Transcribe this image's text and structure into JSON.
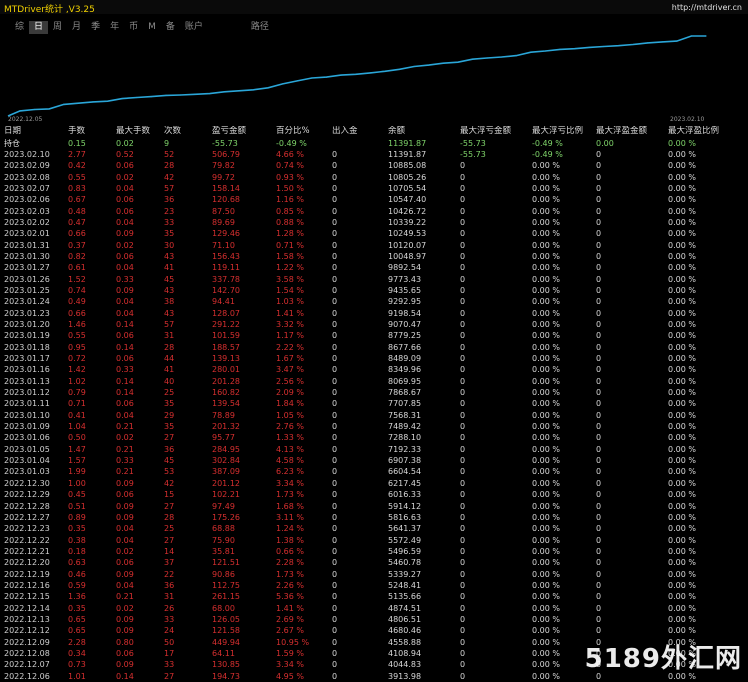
{
  "app": {
    "title": "MTDriver统计 ,V3.25",
    "url": "http://mtdriver.cn"
  },
  "tabs": [
    {
      "label": "综",
      "active": false
    },
    {
      "label": "日",
      "active": true
    },
    {
      "label": "周",
      "active": false
    },
    {
      "label": "月",
      "active": false
    },
    {
      "label": "季",
      "active": false
    },
    {
      "label": "年",
      "active": false
    },
    {
      "label": "币",
      "active": false
    },
    {
      "label": "M",
      "active": false
    },
    {
      "label": "备",
      "active": false
    },
    {
      "label": "账户",
      "active": false
    },
    {
      "label": "路径",
      "active": false
    }
  ],
  "chart_data": {
    "type": "line",
    "title": "",
    "xlabel": "",
    "ylabel": "",
    "x_start_label": "2022.12.05",
    "x_end_label": "2023.02.10",
    "line_color": "#2aa6d8",
    "grid": false,
    "series": [
      {
        "x": [
          "2022.12.06",
          "2022.12.07",
          "2022.12.08",
          "2022.12.09",
          "2022.12.12",
          "2022.12.13",
          "2022.12.14",
          "2022.12.15",
          "2022.12.16",
          "2022.12.19",
          "2022.12.20",
          "2022.12.21",
          "2022.12.22",
          "2022.12.23",
          "2022.12.26",
          "2022.12.27",
          "2022.12.28",
          "2022.12.29",
          "2022.12.30",
          "2023.01.03",
          "2023.01.04",
          "2023.01.05",
          "2023.01.06",
          "2023.01.09",
          "2023.01.10",
          "2023.01.11",
          "2023.01.12",
          "2023.01.13",
          "2023.01.16",
          "2023.01.17",
          "2023.01.18",
          "2023.01.19",
          "2023.01.20",
          "2023.01.23",
          "2023.01.24",
          "2023.01.25",
          "2023.01.26",
          "2023.01.27",
          "2023.01.30",
          "2023.01.31",
          "2023.02.01",
          "2023.02.02",
          "2023.02.03",
          "2023.02.06",
          "2023.02.07",
          "2023.02.08",
          "2023.02.09",
          "2023.02.10"
        ],
        "values": [
          3913.98,
          4044.83,
          4108.94,
          4558.88,
          4680.46,
          4806.51,
          4874.51,
          5135.66,
          5248.41,
          5339.27,
          5460.78,
          5496.59,
          5572.49,
          5641.37,
          5816.63,
          5914.12,
          6016.33,
          6217.45,
          6604.54,
          6907.38,
          7192.33,
          7288.1,
          7489.42,
          7568.31,
          7707.85,
          7868.67,
          8069.95,
          8349.96,
          8489.09,
          8677.66,
          8779.25,
          9070.47,
          9198.54,
          9292.95,
          9435.65,
          9773.43,
          9892.54,
          10048.97,
          10120.07,
          10249.53,
          10339.22,
          10426.72,
          10547.4,
          10705.54,
          10805.26,
          10885.08,
          11391.87,
          11391.87
        ]
      }
    ]
  },
  "table": {
    "headers": [
      "日期",
      "手数",
      "最大手数",
      "次数",
      "盈亏金额",
      "百分比%",
      "出入金",
      "余额",
      "最大浮亏金额",
      "最大浮亏比例",
      "最大浮盈金额",
      "最大浮盈比例"
    ],
    "hold_row": [
      "持仓",
      "0.15",
      "0.02",
      "9",
      "-55.73",
      "-0.49 %",
      "",
      "11391.87",
      "-55.73",
      "-0.49 %",
      "0.00",
      "0.00 %"
    ],
    "rows": [
      [
        "2023.02.10",
        "2.77",
        "0.52",
        "52",
        "506.79",
        "4.66 %",
        "0",
        "11391.87",
        "-55.73",
        "-0.49 %",
        "0",
        "0.00 %"
      ],
      [
        "2023.02.09",
        "0.42",
        "0.06",
        "28",
        "79.82",
        "0.74 %",
        "0",
        "10885.08",
        "0",
        "0.00 %",
        "0",
        "0.00 %"
      ],
      [
        "2023.02.08",
        "0.55",
        "0.02",
        "42",
        "99.72",
        "0.93 %",
        "0",
        "10805.26",
        "0",
        "0.00 %",
        "0",
        "0.00 %"
      ],
      [
        "2023.02.07",
        "0.83",
        "0.04",
        "57",
        "158.14",
        "1.50 %",
        "0",
        "10705.54",
        "0",
        "0.00 %",
        "0",
        "0.00 %"
      ],
      [
        "2023.02.06",
        "0.67",
        "0.06",
        "36",
        "120.68",
        "1.16 %",
        "0",
        "10547.40",
        "0",
        "0.00 %",
        "0",
        "0.00 %"
      ],
      [
        "2023.02.03",
        "0.48",
        "0.06",
        "23",
        "87.50",
        "0.85 %",
        "0",
        "10426.72",
        "0",
        "0.00 %",
        "0",
        "0.00 %"
      ],
      [
        "2023.02.02",
        "0.47",
        "0.04",
        "33",
        "89.69",
        "0.88 %",
        "0",
        "10339.22",
        "0",
        "0.00 %",
        "0",
        "0.00 %"
      ],
      [
        "2023.02.01",
        "0.66",
        "0.09",
        "35",
        "129.46",
        "1.28 %",
        "0",
        "10249.53",
        "0",
        "0.00 %",
        "0",
        "0.00 %"
      ],
      [
        "2023.01.31",
        "0.37",
        "0.02",
        "30",
        "71.10",
        "0.71 %",
        "0",
        "10120.07",
        "0",
        "0.00 %",
        "0",
        "0.00 %"
      ],
      [
        "2023.01.30",
        "0.82",
        "0.06",
        "43",
        "156.43",
        "1.58 %",
        "0",
        "10048.97",
        "0",
        "0.00 %",
        "0",
        "0.00 %"
      ],
      [
        "2023.01.27",
        "0.61",
        "0.04",
        "41",
        "119.11",
        "1.22 %",
        "0",
        "9892.54",
        "0",
        "0.00 %",
        "0",
        "0.00 %"
      ],
      [
        "2023.01.26",
        "1.52",
        "0.33",
        "45",
        "337.78",
        "3.58 %",
        "0",
        "9773.43",
        "0",
        "0.00 %",
        "0",
        "0.00 %"
      ],
      [
        "2023.01.25",
        "0.74",
        "0.09",
        "43",
        "142.70",
        "1.54 %",
        "0",
        "9435.65",
        "0",
        "0.00 %",
        "0",
        "0.00 %"
      ],
      [
        "2023.01.24",
        "0.49",
        "0.04",
        "38",
        "94.41",
        "1.03 %",
        "0",
        "9292.95",
        "0",
        "0.00 %",
        "0",
        "0.00 %"
      ],
      [
        "2023.01.23",
        "0.66",
        "0.04",
        "43",
        "128.07",
        "1.41 %",
        "0",
        "9198.54",
        "0",
        "0.00 %",
        "0",
        "0.00 %"
      ],
      [
        "2023.01.20",
        "1.46",
        "0.14",
        "57",
        "291.22",
        "3.32 %",
        "0",
        "9070.47",
        "0",
        "0.00 %",
        "0",
        "0.00 %"
      ],
      [
        "2023.01.19",
        "0.55",
        "0.06",
        "31",
        "101.59",
        "1.17 %",
        "0",
        "8779.25",
        "0",
        "0.00 %",
        "0",
        "0.00 %"
      ],
      [
        "2023.01.18",
        "0.95",
        "0.14",
        "28",
        "188.57",
        "2.22 %",
        "0",
        "8677.66",
        "0",
        "0.00 %",
        "0",
        "0.00 %"
      ],
      [
        "2023.01.17",
        "0.72",
        "0.06",
        "44",
        "139.13",
        "1.67 %",
        "0",
        "8489.09",
        "0",
        "0.00 %",
        "0",
        "0.00 %"
      ],
      [
        "2023.01.16",
        "1.42",
        "0.33",
        "41",
        "280.01",
        "3.47 %",
        "0",
        "8349.96",
        "0",
        "0.00 %",
        "0",
        "0.00 %"
      ],
      [
        "2023.01.13",
        "1.02",
        "0.14",
        "40",
        "201.28",
        "2.56 %",
        "0",
        "8069.95",
        "0",
        "0.00 %",
        "0",
        "0.00 %"
      ],
      [
        "2023.01.12",
        "0.79",
        "0.14",
        "25",
        "160.82",
        "2.09 %",
        "0",
        "7868.67",
        "0",
        "0.00 %",
        "0",
        "0.00 %"
      ],
      [
        "2023.01.11",
        "0.71",
        "0.06",
        "35",
        "139.54",
        "1.84 %",
        "0",
        "7707.85",
        "0",
        "0.00 %",
        "0",
        "0.00 %"
      ],
      [
        "2023.01.10",
        "0.41",
        "0.04",
        "29",
        "78.89",
        "1.05 %",
        "0",
        "7568.31",
        "0",
        "0.00 %",
        "0",
        "0.00 %"
      ],
      [
        "2023.01.09",
        "1.04",
        "0.21",
        "35",
        "201.32",
        "2.76 %",
        "0",
        "7489.42",
        "0",
        "0.00 %",
        "0",
        "0.00 %"
      ],
      [
        "2023.01.06",
        "0.50",
        "0.02",
        "27",
        "95.77",
        "1.33 %",
        "0",
        "7288.10",
        "0",
        "0.00 %",
        "0",
        "0.00 %"
      ],
      [
        "2023.01.05",
        "1.47",
        "0.21",
        "36",
        "284.95",
        "4.13 %",
        "0",
        "7192.33",
        "0",
        "0.00 %",
        "0",
        "0.00 %"
      ],
      [
        "2023.01.04",
        "1.57",
        "0.33",
        "45",
        "302.84",
        "4.58 %",
        "0",
        "6907.38",
        "0",
        "0.00 %",
        "0",
        "0.00 %"
      ],
      [
        "2023.01.03",
        "1.99",
        "0.21",
        "53",
        "387.09",
        "6.23 %",
        "0",
        "6604.54",
        "0",
        "0.00 %",
        "0",
        "0.00 %"
      ],
      [
        "2022.12.30",
        "1.00",
        "0.09",
        "42",
        "201.12",
        "3.34 %",
        "0",
        "6217.45",
        "0",
        "0.00 %",
        "0",
        "0.00 %"
      ],
      [
        "2022.12.29",
        "0.45",
        "0.06",
        "15",
        "102.21",
        "1.73 %",
        "0",
        "6016.33",
        "0",
        "0.00 %",
        "0",
        "0.00 %"
      ],
      [
        "2022.12.28",
        "0.51",
        "0.09",
        "27",
        "97.49",
        "1.68 %",
        "0",
        "5914.12",
        "0",
        "0.00 %",
        "0",
        "0.00 %"
      ],
      [
        "2022.12.27",
        "0.89",
        "0.09",
        "28",
        "175.26",
        "3.11 %",
        "0",
        "5816.63",
        "0",
        "0.00 %",
        "0",
        "0.00 %"
      ],
      [
        "2022.12.23",
        "0.35",
        "0.04",
        "25",
        "68.88",
        "1.24 %",
        "0",
        "5641.37",
        "0",
        "0.00 %",
        "0",
        "0.00 %"
      ],
      [
        "2022.12.22",
        "0.38",
        "0.04",
        "27",
        "75.90",
        "1.38 %",
        "0",
        "5572.49",
        "0",
        "0.00 %",
        "0",
        "0.00 %"
      ],
      [
        "2022.12.21",
        "0.18",
        "0.02",
        "14",
        "35.81",
        "0.66 %",
        "0",
        "5496.59",
        "0",
        "0.00 %",
        "0",
        "0.00 %"
      ],
      [
        "2022.12.20",
        "0.63",
        "0.06",
        "37",
        "121.51",
        "2.28 %",
        "0",
        "5460.78",
        "0",
        "0.00 %",
        "0",
        "0.00 %"
      ],
      [
        "2022.12.19",
        "0.46",
        "0.09",
        "22",
        "90.86",
        "1.73 %",
        "0",
        "5339.27",
        "0",
        "0.00 %",
        "0",
        "0.00 %"
      ],
      [
        "2022.12.16",
        "0.59",
        "0.04",
        "36",
        "112.75",
        "2.26 %",
        "0",
        "5248.41",
        "0",
        "0.00 %",
        "0",
        "0.00 %"
      ],
      [
        "2022.12.15",
        "1.36",
        "0.21",
        "31",
        "261.15",
        "5.36 %",
        "0",
        "5135.66",
        "0",
        "0.00 %",
        "0",
        "0.00 %"
      ],
      [
        "2022.12.14",
        "0.35",
        "0.02",
        "26",
        "68.00",
        "1.41 %",
        "0",
        "4874.51",
        "0",
        "0.00 %",
        "0",
        "0.00 %"
      ],
      [
        "2022.12.13",
        "0.65",
        "0.09",
        "33",
        "126.05",
        "2.69 %",
        "0",
        "4806.51",
        "0",
        "0.00 %",
        "0",
        "0.00 %"
      ],
      [
        "2022.12.12",
        "0.65",
        "0.09",
        "24",
        "121.58",
        "2.67 %",
        "0",
        "4680.46",
        "0",
        "0.00 %",
        "0",
        "0.00 %"
      ],
      [
        "2022.12.09",
        "2.28",
        "0.80",
        "50",
        "449.94",
        "10.95 %",
        "0",
        "4558.88",
        "0",
        "0.00 %",
        "0",
        "0.00 %"
      ],
      [
        "2022.12.08",
        "0.34",
        "0.06",
        "17",
        "64.11",
        "1.59 %",
        "0",
        "4108.94",
        "0",
        "0.00 %",
        "0",
        "0.00 %"
      ],
      [
        "2022.12.07",
        "0.73",
        "0.09",
        "33",
        "130.85",
        "3.34 %",
        "0",
        "4044.83",
        "0",
        "0.00 %",
        "0",
        "0.00 %"
      ],
      [
        "2022.12.06",
        "1.01",
        "0.14",
        "27",
        "194.73",
        "4.95 %",
        "0",
        "3913.98",
        "0",
        "0.00 %",
        "0",
        "0.00 %"
      ]
    ]
  },
  "watermark": "5189外汇网",
  "colors": {
    "positive": "#d62f2f",
    "hold": "#7fd46a",
    "neutral": "#d8d8d8",
    "title": "#f0d000"
  }
}
